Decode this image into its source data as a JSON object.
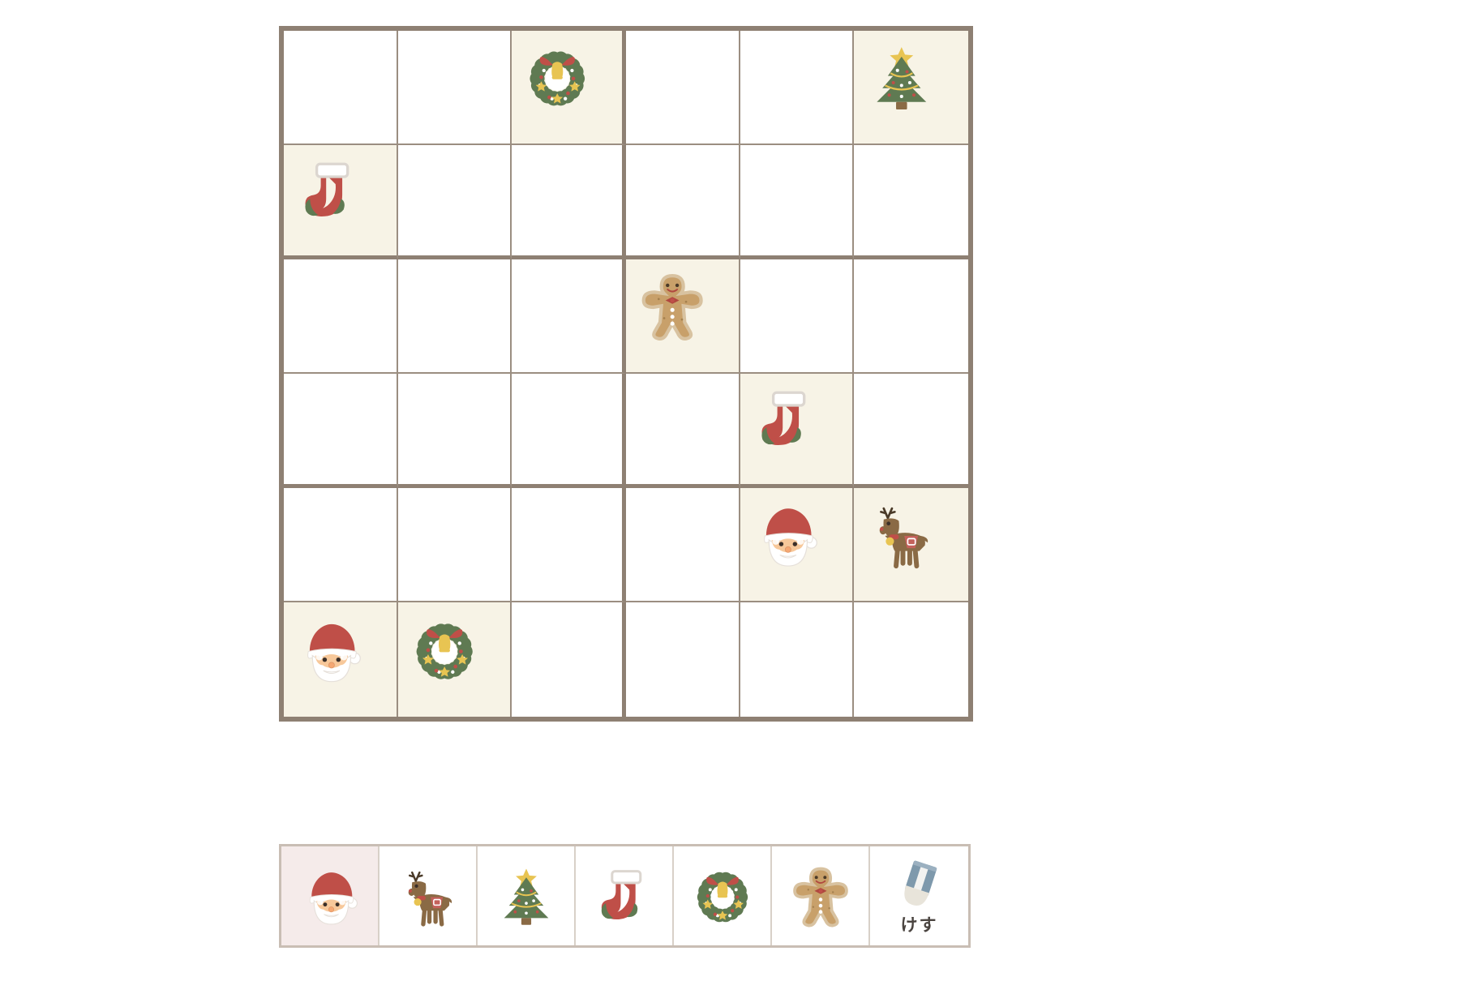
{
  "app": {
    "title": "Christmas Picture Sudoku",
    "colors": {
      "board_border": "#8E8073",
      "grid_line": "#9B8E81",
      "given_cell_bg": "#F7F3E6",
      "empty_cell_bg": "#FFFFFF",
      "palette_border": "#C9BEB4",
      "selected_bg": "#F5EBEA",
      "santa_red": "#BF4F48",
      "tree_green": "#5F7A52",
      "gold": "#E8C452",
      "gingerbread": "#C8A06A"
    }
  },
  "board": {
    "rows": 6,
    "cols": 6,
    "block_cols": 3,
    "block_rows": 2,
    "cells": [
      [
        {
          "icon": "",
          "given": false
        },
        {
          "icon": "",
          "given": false
        },
        {
          "icon": "wreath-icon",
          "given": true
        },
        {
          "icon": "",
          "given": false
        },
        {
          "icon": "",
          "given": false
        },
        {
          "icon": "tree-icon",
          "given": true
        }
      ],
      [
        {
          "icon": "stocking-icon",
          "given": true
        },
        {
          "icon": "",
          "given": false
        },
        {
          "icon": "",
          "given": false
        },
        {
          "icon": "",
          "given": false
        },
        {
          "icon": "",
          "given": false
        },
        {
          "icon": "",
          "given": false
        }
      ],
      [
        {
          "icon": "",
          "given": false
        },
        {
          "icon": "",
          "given": false
        },
        {
          "icon": "",
          "given": false
        },
        {
          "icon": "gingerbread-icon",
          "given": true
        },
        {
          "icon": "",
          "given": false
        },
        {
          "icon": "",
          "given": false
        }
      ],
      [
        {
          "icon": "",
          "given": false
        },
        {
          "icon": "",
          "given": false
        },
        {
          "icon": "",
          "given": false
        },
        {
          "icon": "",
          "given": false
        },
        {
          "icon": "stocking-icon",
          "given": true
        },
        {
          "icon": "",
          "given": false
        }
      ],
      [
        {
          "icon": "",
          "given": false
        },
        {
          "icon": "",
          "given": false
        },
        {
          "icon": "",
          "given": false
        },
        {
          "icon": "",
          "given": false
        },
        {
          "icon": "santa-icon",
          "given": true
        },
        {
          "icon": "reindeer-icon",
          "given": true
        }
      ],
      [
        {
          "icon": "santa-icon",
          "given": true
        },
        {
          "icon": "wreath-icon",
          "given": true
        },
        {
          "icon": "",
          "given": false
        },
        {
          "icon": "",
          "given": false
        },
        {
          "icon": "",
          "given": false
        },
        {
          "icon": "",
          "given": false
        }
      ]
    ]
  },
  "palette": {
    "selected_index": 0,
    "items": [
      {
        "icon": "santa-icon",
        "label": "",
        "selected": true
      },
      {
        "icon": "reindeer-icon",
        "label": "",
        "selected": false
      },
      {
        "icon": "tree-icon",
        "label": "",
        "selected": false
      },
      {
        "icon": "stocking-icon",
        "label": "",
        "selected": false
      },
      {
        "icon": "wreath-icon",
        "label": "",
        "selected": false
      },
      {
        "icon": "gingerbread-icon",
        "label": "",
        "selected": false
      },
      {
        "icon": "eraser-icon",
        "label": "けす",
        "selected": false
      }
    ]
  }
}
